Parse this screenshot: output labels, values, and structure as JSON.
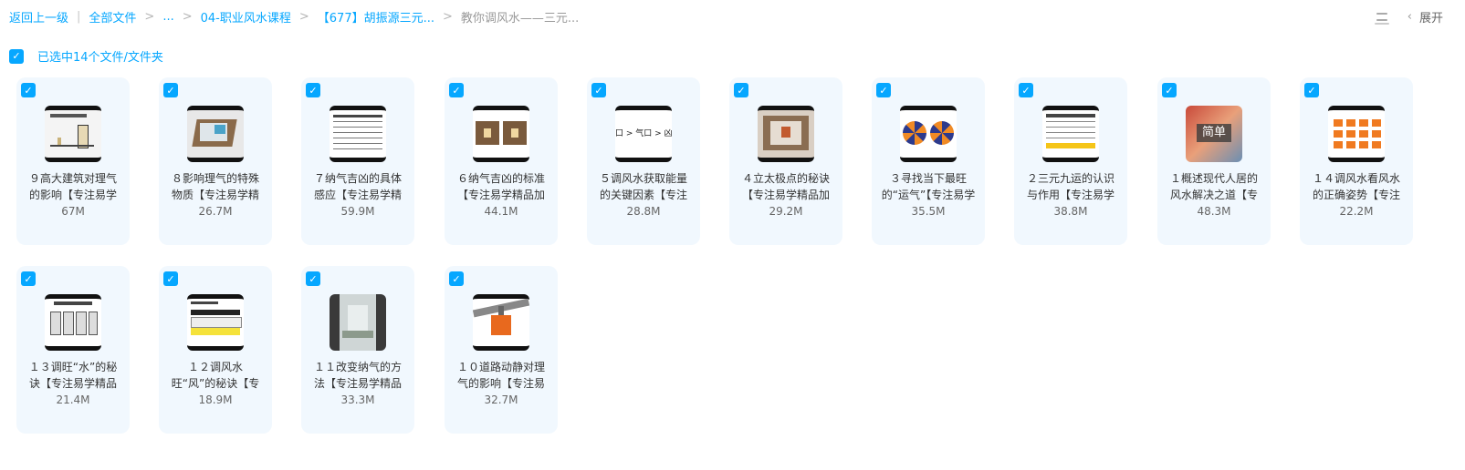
{
  "breadcrumb": {
    "back": "返回上一级",
    "items": [
      "全部文件",
      "...",
      "04-职业风水课程",
      "【677】胡振源三元...",
      "教你调风水——三元..."
    ],
    "separator": ">"
  },
  "toolbar": {
    "expand_label": "展开"
  },
  "selection": {
    "label": "已选中14个文件/文件夹"
  },
  "files": [
    {
      "name": "９高大建筑对理气的影响【专注易学",
      "size": "67M"
    },
    {
      "name": "８影响理气的特殊物质【专注易学精",
      "size": "26.7M"
    },
    {
      "name": "７纳气吉凶的具体感应【专注易学精",
      "size": "59.9M"
    },
    {
      "name": "６纳气吉凶的标准【专注易学精品加",
      "size": "44.1M"
    },
    {
      "name": "５调风水获取能量的关键因素【专注",
      "size": "28.8M"
    },
    {
      "name": "４立太极点的秘诀【专注易学精品加",
      "size": "29.2M"
    },
    {
      "name": "３寻找当下最旺的“运气”【专注易学",
      "size": "35.5M"
    },
    {
      "name": "２三元九运的认识与作用【专注易学",
      "size": "38.8M"
    },
    {
      "name": "１概述现代人居的风水解决之道【专",
      "size": "48.3M"
    },
    {
      "name": "１４调风水看风水的正确姿势【专注",
      "size": "22.2M"
    },
    {
      "name": "１３调旺“水”的秘诀【专注易学精品",
      "size": "21.4M"
    },
    {
      "name": "１２调风水旺“风”的秘诀【专注易学",
      "size": "18.9M"
    },
    {
      "name": "１１改变纳气的方法【专注易学精品",
      "size": "33.3M"
    },
    {
      "name": "１０道路动静对理气的影响【专注易",
      "size": "32.7M"
    }
  ],
  "thumb_texts": {
    "t5": "口 > 气口 > 凶",
    "t9": "简单"
  },
  "colors": {
    "accent": "#06a7ff",
    "card_bg": "#f1f8fe"
  }
}
